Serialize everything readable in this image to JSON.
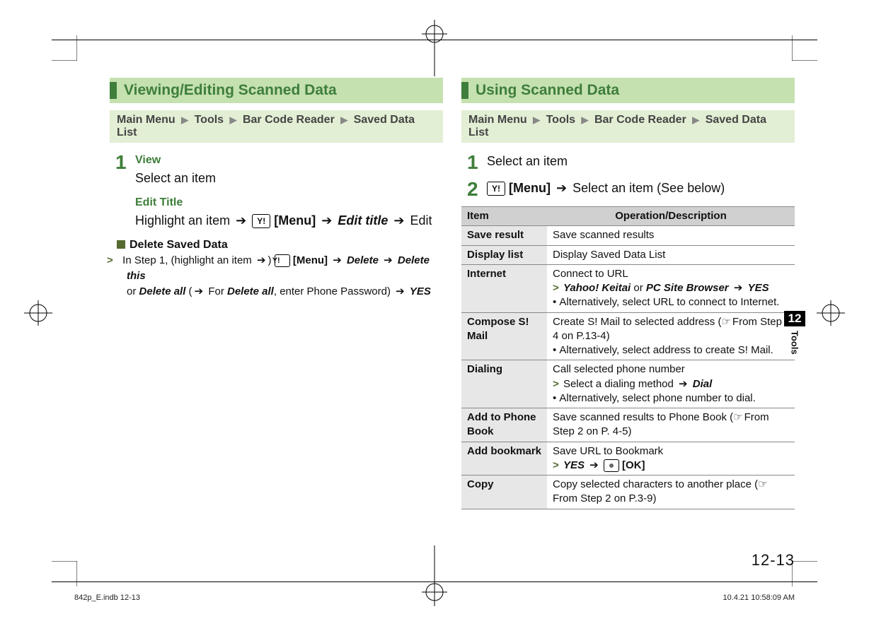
{
  "left_section": {
    "title": "Viewing/Editing Scanned Data",
    "breadcrumb": [
      "Main Menu",
      "Tools",
      "Bar Code Reader",
      "Saved Data List"
    ],
    "steps": [
      {
        "num": "1",
        "subtitle": "View",
        "line1": "Select an item"
      }
    ],
    "edit": {
      "subtitle": "Edit Title",
      "pre": "Highlight an item",
      "menu": "[Menu]",
      "cmd": "Edit title",
      "post": "Edit"
    },
    "delete": {
      "heading": "Delete Saved Data",
      "lead": "In Step 1, (highlight an item",
      "menu": "[Menu]",
      "del": "Delete",
      "del_this": "Delete this",
      "or": "or",
      "del_all": "Delete all",
      "for": "For",
      "del_all2": "Delete all",
      "enter_pw": ", enter Phone Password)",
      "yes": "YES"
    }
  },
  "right_section": {
    "title": "Using Scanned Data",
    "breadcrumb": [
      "Main Menu",
      "Tools",
      "Bar Code Reader",
      "Saved Data List"
    ],
    "step1": {
      "num": "1",
      "text": "Select an item"
    },
    "step2": {
      "num": "2",
      "menu": "[Menu]",
      "text": "Select an item (See below)"
    },
    "table": {
      "headers": [
        "Item",
        "Operation/Description"
      ],
      "rows": [
        {
          "name": "Save result",
          "lines": [
            "Save scanned results"
          ]
        },
        {
          "name": "Display list",
          "lines": [
            "Display Saved Data List"
          ]
        },
        {
          "name": "Internet",
          "type": "internet"
        },
        {
          "name": "Compose S! Mail",
          "type": "compose"
        },
        {
          "name": "Dialing",
          "type": "dialing"
        },
        {
          "name": "Add to Phone Book",
          "type": "phonebook"
        },
        {
          "name": "Add bookmark",
          "type": "bookmark"
        },
        {
          "name": "Copy",
          "type": "copy"
        }
      ]
    },
    "text": {
      "connect": "Connect to URL",
      "yahoo": "Yahoo! Keitai",
      "or": "or",
      "pcsite": "PC Site Browser",
      "yes": "YES",
      "alt_url": "Alternatively, select URL to connect to Internet.",
      "create_mail": "Create S! Mail to selected address (",
      "from4": "From Step 4 on P.13-4)",
      "alt_mail": "Alternatively, select address to create S! Mail.",
      "call": "Call selected phone number",
      "sel_dial": "Select a dialing method",
      "dial": "Dial",
      "alt_dial": "Alternatively, select phone number to dial.",
      "save_pb": "Save scanned results to Phone Book (",
      "from2a": "From Step 2 on P. 4-5)",
      "save_bm": "Save URL to Bookmark",
      "ok": "[OK]",
      "copy": "Copy selected characters to another place (",
      "from2b": "From Step 2 on P.3-9)"
    }
  },
  "side": {
    "num": "12",
    "label": "Tools"
  },
  "page_number": "12-13",
  "footer": {
    "left": "842p_E.indb   12-13",
    "right": "10.4.21   10:58:09 AM"
  }
}
